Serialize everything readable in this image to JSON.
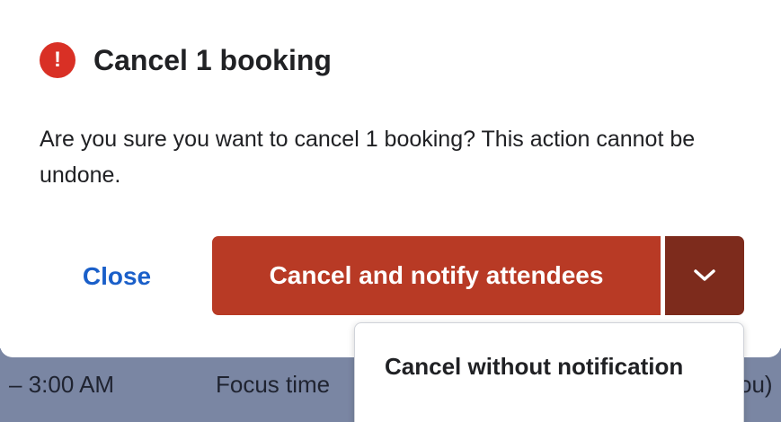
{
  "background_event": {
    "time": "– 3:00 AM",
    "title": "Focus time",
    "tail": "ou)"
  },
  "dialog": {
    "title": "Cancel 1 booking",
    "message": "Are you sure you want to cancel 1 booking? This action cannot be undone.",
    "icon": "alert-icon",
    "icon_glyph": "!",
    "close_label": "Close",
    "primary_label": "Cancel and notify attendees",
    "dropdown_icon": "chevron-down-icon",
    "menu": {
      "items": [
        {
          "label": "Cancel without notification"
        }
      ]
    }
  },
  "colors": {
    "accent_red": "#b83a25",
    "dark_red": "#7d2b1c",
    "alert_red": "#d93025",
    "link_blue": "#1a5fc9",
    "background_strip": "#7a86a3"
  }
}
